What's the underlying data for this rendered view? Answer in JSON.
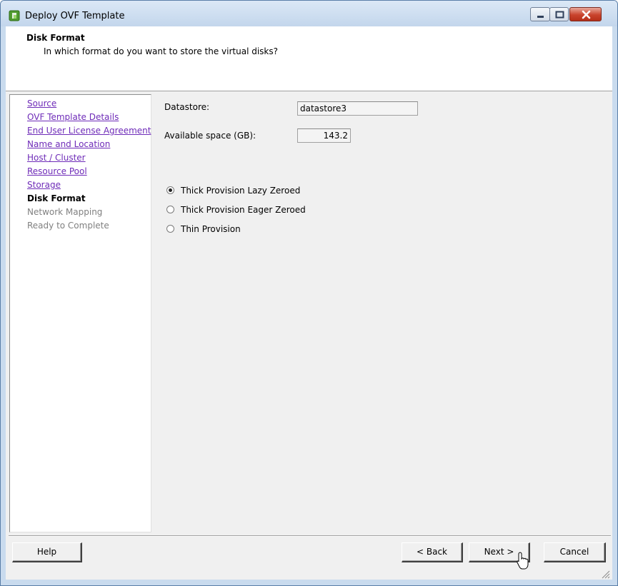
{
  "window": {
    "title": "Deploy OVF Template"
  },
  "header": {
    "title": "Disk Format",
    "subtitle": "In which format do you want to store the virtual disks?"
  },
  "nav": {
    "items": [
      {
        "label": "Source",
        "state": "link"
      },
      {
        "label": "OVF Template Details",
        "state": "link"
      },
      {
        "label": "End User License Agreement",
        "state": "link"
      },
      {
        "label": "Name and Location",
        "state": "link"
      },
      {
        "label": "Host / Cluster",
        "state": "link"
      },
      {
        "label": "Resource Pool",
        "state": "link"
      },
      {
        "label": "Storage",
        "state": "link"
      },
      {
        "label": "Disk Format",
        "state": "current"
      },
      {
        "label": "Network Mapping",
        "state": "disabled"
      },
      {
        "label": "Ready to Complete",
        "state": "disabled"
      }
    ]
  },
  "form": {
    "datastore_label": "Datastore:",
    "datastore_value": "datastore3",
    "space_label": "Available space (GB):",
    "space_value": "143.2",
    "options": [
      {
        "label": "Thick Provision Lazy Zeroed",
        "selected": true
      },
      {
        "label": "Thick Provision Eager Zeroed",
        "selected": false
      },
      {
        "label": "Thin Provision",
        "selected": false
      }
    ]
  },
  "footer": {
    "help": "Help",
    "back": "< Back",
    "next": "Next >",
    "cancel": "Cancel"
  },
  "colors": {
    "link": "#6e2bb8",
    "disabled": "#808080",
    "titlebar": "#c9dbee"
  }
}
